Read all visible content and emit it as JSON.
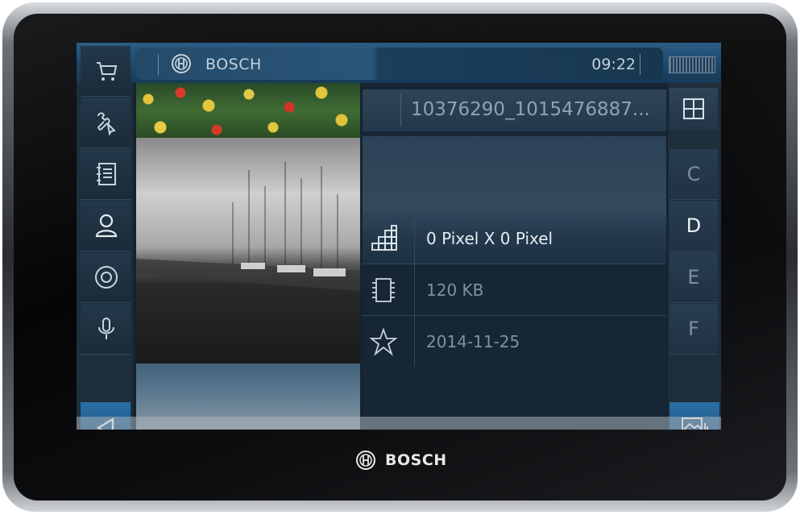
{
  "status": {
    "brand": "BOSCH",
    "time": "09:22"
  },
  "file": {
    "name": "10376290_1015476887..."
  },
  "details": [
    {
      "icon": "resolution-grid-icon",
      "value": "0 Pixel X 0 Pixel"
    },
    {
      "icon": "memory-chip-icon",
      "value": "120 KB"
    },
    {
      "icon": "star-outline-icon",
      "value": "2014-11-25"
    }
  ],
  "alphabet": [
    "C",
    "D",
    "E",
    "F"
  ],
  "selected_letter": "D",
  "left_nav": [
    {
      "icon": "shopping-cart-icon"
    },
    {
      "icon": "tools-settings-icon"
    },
    {
      "icon": "notebook-icon"
    },
    {
      "icon": "person-icon"
    },
    {
      "icon": "disc-icon"
    },
    {
      "icon": "microphone-icon"
    }
  ],
  "device": {
    "brand": "BOSCH"
  },
  "colors": {
    "accent": "#2a6ea3",
    "statusbar": "#1c4566",
    "selected_text": "#e6edf2"
  }
}
